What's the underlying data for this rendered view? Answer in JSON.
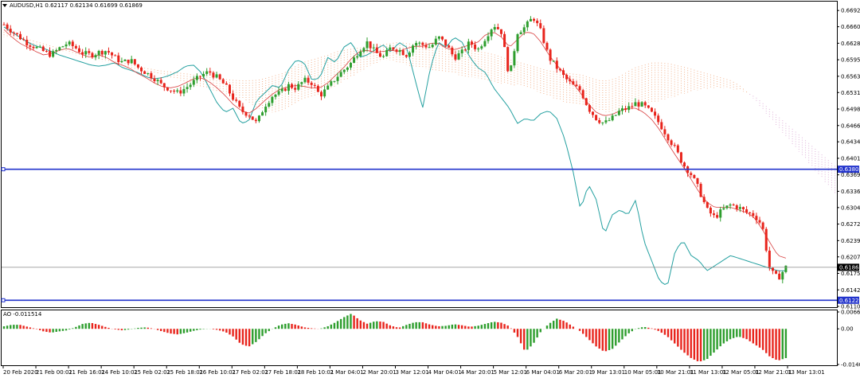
{
  "window": {
    "symbol_header": "AUDUSD,H1  0.62117 0.62134 0.61699 0.61869",
    "indicator_header": "AO -0.011514"
  },
  "colors": {
    "bull": "#2e9e2e",
    "bear": "#e8241c",
    "tenkan": "#d84040",
    "kijun": "#24a0a0",
    "cloud_up": "#f0a070",
    "cloud_down": "#d8a0d0",
    "support_line": "#2233cc",
    "price_line": "#888888",
    "label_bg": "#000000",
    "support_label_bg": "#2233cc"
  },
  "chart_data": [
    {
      "type": "line",
      "subtype": "candlestick-with-ichimoku",
      "title": "AUDUSD,H1",
      "ohlc_header": {
        "open": 0.62117,
        "high": 0.62134,
        "low": 0.61699,
        "close": 0.61869
      },
      "y_ticks": [
        "0.66925",
        "0.66605",
        "0.66280",
        "0.65955",
        "0.65630",
        "0.65310",
        "0.64985",
        "0.64660",
        "0.64340",
        "0.64015",
        "0.63690",
        "0.63365",
        "0.63045",
        "0.62720",
        "0.62395",
        "0.62075",
        "0.61750",
        "0.61425",
        "0.61100"
      ],
      "ylim": [
        0.611,
        0.671
      ],
      "x_ticks": [
        "20 Feb 2020",
        "21 Feb 00:01",
        "21 Feb 16:01",
        "24 Feb 10:01",
        "25 Feb 02:01",
        "25 Feb 18:01",
        "26 Feb 10:01",
        "27 Feb 02:01",
        "27 Feb 18:01",
        "28 Feb 10:01",
        "2 Mar 04:01",
        "2 Mar 20:01",
        "3 Mar 12:01",
        "4 Mar 04:01",
        "4 Mar 20:01",
        "5 Mar 12:01",
        "6 Mar 04:01",
        "6 Mar 20:01",
        "9 Mar 13:01",
        "10 Mar 05:01",
        "10 Mar 21:01",
        "11 Mar 13:01",
        "12 Mar 05:01",
        "12 Mar 21:01",
        "13 Mar 13:01"
      ],
      "horizontal_lines": [
        {
          "label": "0.63800",
          "value": 0.638,
          "style": "support"
        },
        {
          "label": "0.61869",
          "value": 0.61869,
          "style": "current-price"
        },
        {
          "label": "0.61221",
          "value": 0.61221,
          "style": "support"
        }
      ],
      "close_path": [
        0.6665,
        0.6652,
        0.664,
        0.6628,
        0.662,
        0.6612,
        0.6605,
        0.6618,
        0.6628,
        0.662,
        0.6608,
        0.6605,
        0.661,
        0.6614,
        0.66,
        0.659,
        0.6595,
        0.658,
        0.657,
        0.656,
        0.6545,
        0.6538,
        0.653,
        0.654,
        0.6552,
        0.6565,
        0.6572,
        0.656,
        0.6545,
        0.652,
        0.6495,
        0.6488,
        0.647,
        0.6505,
        0.6525,
        0.653,
        0.6545,
        0.654,
        0.6555,
        0.655,
        0.6525,
        0.654,
        0.656,
        0.6575,
        0.659,
        0.6615,
        0.663,
        0.661,
        0.66,
        0.662,
        0.6615,
        0.6605,
        0.663,
        0.6625,
        0.662,
        0.664,
        0.6625,
        0.66,
        0.661,
        0.663,
        0.6615,
        0.664,
        0.6665,
        0.665,
        0.656,
        0.665,
        0.666,
        0.668,
        0.665,
        0.66,
        0.658,
        0.656,
        0.6545,
        0.6535,
        0.65,
        0.648,
        0.647,
        0.648,
        0.6495,
        0.65,
        0.651,
        0.6505,
        0.649,
        0.647,
        0.6445,
        0.642,
        0.639,
        0.637,
        0.634,
        0.63,
        0.6285,
        0.63,
        0.631,
        0.6305,
        0.6295,
        0.629,
        0.627,
        0.618,
        0.6165,
        0.6187
      ],
      "tenkan_path": [
        0.6655,
        0.664,
        0.6628,
        0.662,
        0.6612,
        0.6605,
        0.6608,
        0.6614,
        0.6618,
        0.6612,
        0.6605,
        0.66,
        0.6605,
        0.66,
        0.659,
        0.6585,
        0.6578,
        0.6568,
        0.656,
        0.655,
        0.6543,
        0.654,
        0.6543,
        0.655,
        0.6558,
        0.656,
        0.6552,
        0.654,
        0.6525,
        0.6508,
        0.6496,
        0.649,
        0.65,
        0.6515,
        0.6528,
        0.6538,
        0.6542,
        0.6545,
        0.6543,
        0.654,
        0.654,
        0.655,
        0.6565,
        0.658,
        0.6598,
        0.6612,
        0.6614,
        0.661,
        0.6612,
        0.6614,
        0.6612,
        0.6618,
        0.6622,
        0.6622,
        0.6628,
        0.6628,
        0.6618,
        0.6615,
        0.662,
        0.6625,
        0.663,
        0.6645,
        0.665,
        0.664,
        0.662,
        0.6635,
        0.665,
        0.6648,
        0.663,
        0.6605,
        0.6585,
        0.6568,
        0.655,
        0.653,
        0.6508,
        0.6492,
        0.6485,
        0.6488,
        0.6495,
        0.65,
        0.65,
        0.6492,
        0.6478,
        0.6458,
        0.6432,
        0.6408,
        0.6385,
        0.636,
        0.6335,
        0.6315,
        0.6305,
        0.6305,
        0.6305,
        0.63,
        0.6295,
        0.6285,
        0.6262,
        0.6235,
        0.621,
        0.6205
      ],
      "kijun_path": [
        0.666,
        0.665,
        0.664,
        0.663,
        0.6623,
        0.6618,
        0.6612,
        0.6605,
        0.66,
        0.6595,
        0.659,
        0.6585,
        0.6583,
        0.6585,
        0.659,
        0.658,
        0.6575,
        0.657,
        0.6562,
        0.6558,
        0.656,
        0.6565,
        0.6572,
        0.6583,
        0.6585,
        0.657,
        0.654,
        0.651,
        0.6492,
        0.65,
        0.647,
        0.6475,
        0.6515,
        0.653,
        0.6545,
        0.654,
        0.6575,
        0.6595,
        0.659,
        0.6555,
        0.656,
        0.66,
        0.659,
        0.662,
        0.663,
        0.66,
        0.6605,
        0.6615,
        0.6625,
        0.661,
        0.663,
        0.662,
        0.656,
        0.65,
        0.658,
        0.663,
        0.662,
        0.664,
        0.663,
        0.66,
        0.658,
        0.657,
        0.654,
        0.652,
        0.65,
        0.647,
        0.648,
        0.6475,
        0.649,
        0.6495,
        0.648,
        0.644,
        0.638,
        0.63,
        0.635,
        0.632,
        0.625,
        0.629,
        0.63,
        0.629,
        0.632,
        0.624,
        0.62,
        0.616,
        0.615,
        0.622,
        0.624,
        0.621,
        0.62,
        0.618,
        0.619,
        0.62,
        0.621,
        0.6205,
        0.62,
        0.6195,
        0.619,
        0.6185,
        0.618,
        0.618
      ],
      "cloud_top": [
        0.665,
        0.6645,
        0.664,
        0.6635,
        0.663,
        0.6625,
        0.662,
        0.6615,
        0.661,
        0.6605,
        0.66,
        0.6598,
        0.6595,
        0.6592,
        0.6588,
        0.6584,
        0.658,
        0.6577,
        0.6574,
        0.6572,
        0.657,
        0.6568,
        0.6565,
        0.6562,
        0.656,
        0.6558,
        0.6556,
        0.6555,
        0.6555,
        0.6556,
        0.656,
        0.6565,
        0.657,
        0.658,
        0.659,
        0.6595,
        0.66,
        0.6605,
        0.6612,
        0.6615,
        0.6618,
        0.662,
        0.6622,
        0.6625,
        0.6628,
        0.663,
        0.6628,
        0.6626,
        0.6625,
        0.6624,
        0.6622,
        0.662,
        0.6618,
        0.6615,
        0.6612,
        0.661,
        0.6606,
        0.66,
        0.6595,
        0.659,
        0.6585,
        0.658,
        0.6575,
        0.6572,
        0.657,
        0.6568,
        0.6566,
        0.656,
        0.6555,
        0.6555,
        0.656,
        0.657,
        0.658,
        0.6585,
        0.659,
        0.659,
        0.6588,
        0.6584,
        0.658,
        0.6575,
        0.657,
        0.6565,
        0.656,
        0.6555,
        0.6545,
        0.653,
        0.651,
        0.649,
        0.647,
        0.645,
        0.643,
        0.641,
        0.639,
        0.637,
        0.635,
        0.633,
        0.631,
        0.629,
        0.627,
        0.625
      ],
      "cloud_bottom": [
        0.664,
        0.6636,
        0.6632,
        0.6628,
        0.6624,
        0.662,
        0.6615,
        0.661,
        0.6605,
        0.66,
        0.6596,
        0.6593,
        0.659,
        0.6585,
        0.658,
        0.6576,
        0.6572,
        0.6568,
        0.6565,
        0.656,
        0.6555,
        0.655,
        0.6545,
        0.654,
        0.6535,
        0.653,
        0.6525,
        0.652,
        0.651,
        0.65,
        0.6495,
        0.649,
        0.6495,
        0.6505,
        0.6515,
        0.652,
        0.6525,
        0.6535,
        0.6545,
        0.6555,
        0.6565,
        0.6575,
        0.6585,
        0.6592,
        0.6595,
        0.659,
        0.6585,
        0.658,
        0.6578,
        0.6575,
        0.6572,
        0.657,
        0.6565,
        0.6562,
        0.656,
        0.6555,
        0.655,
        0.6548,
        0.6545,
        0.6545,
        0.654,
        0.6532,
        0.6525,
        0.6518,
        0.6512,
        0.6508,
        0.6505,
        0.65,
        0.6495,
        0.6492,
        0.6492,
        0.6495,
        0.65,
        0.6505,
        0.651,
        0.6515,
        0.652,
        0.6525,
        0.653,
        0.6535,
        0.6538,
        0.654,
        0.654,
        0.6538,
        0.6535,
        0.653,
        0.652,
        0.6505,
        0.649,
        0.6475,
        0.646,
        0.6445,
        0.643,
        0.6415,
        0.64,
        0.6385,
        0.637,
        0.6355,
        0.634,
        0.6325
      ]
    },
    {
      "type": "bar",
      "title": "AO -0.011514",
      "y_ticks": [
        "0.006635",
        "0.00",
        "-0.014007"
      ],
      "ylim": [
        -0.014007,
        0.006635
      ],
      "ao_path": [
        0.001,
        0.0016,
        0.0016,
        0.0008,
        0.0,
        -0.001,
        -0.0015,
        -0.001,
        -0.0006,
        0.0006,
        0.002,
        0.0024,
        0.0016,
        0.0006,
        -0.0002,
        -0.0006,
        -0.0002,
        0.0004,
        0.0006,
        0.0,
        -0.001,
        -0.0018,
        -0.0022,
        -0.0016,
        -0.0008,
        -0.0002,
        0.0,
        -0.0004,
        -0.0012,
        -0.003,
        -0.006,
        -0.007,
        -0.005,
        -0.002,
        0.0,
        0.0016,
        0.0022,
        0.0016,
        0.0006,
        0.0002,
        0.0,
        0.001,
        0.0026,
        0.0045,
        0.006,
        0.0035,
        0.002,
        0.003,
        0.0028,
        0.0012,
        0.0004,
        0.0016,
        0.0026,
        0.0026,
        0.0016,
        0.001,
        0.0012,
        0.0018,
        0.0014,
        0.0008,
        0.0012,
        0.002,
        0.0028,
        0.0024,
        0.001,
        -0.003,
        -0.009,
        -0.006,
        -0.001,
        0.002,
        0.004,
        0.003,
        0.001,
        -0.001,
        -0.004,
        -0.007,
        -0.009,
        -0.008,
        -0.005,
        -0.002,
        0.0,
        0.0008,
        0.0002,
        -0.001,
        -0.003,
        -0.006,
        -0.009,
        -0.0115,
        -0.013,
        -0.012,
        -0.009,
        -0.006,
        -0.004,
        -0.003,
        -0.004,
        -0.006,
        -0.008,
        -0.011,
        -0.0125,
        -0.0115
      ]
    }
  ]
}
